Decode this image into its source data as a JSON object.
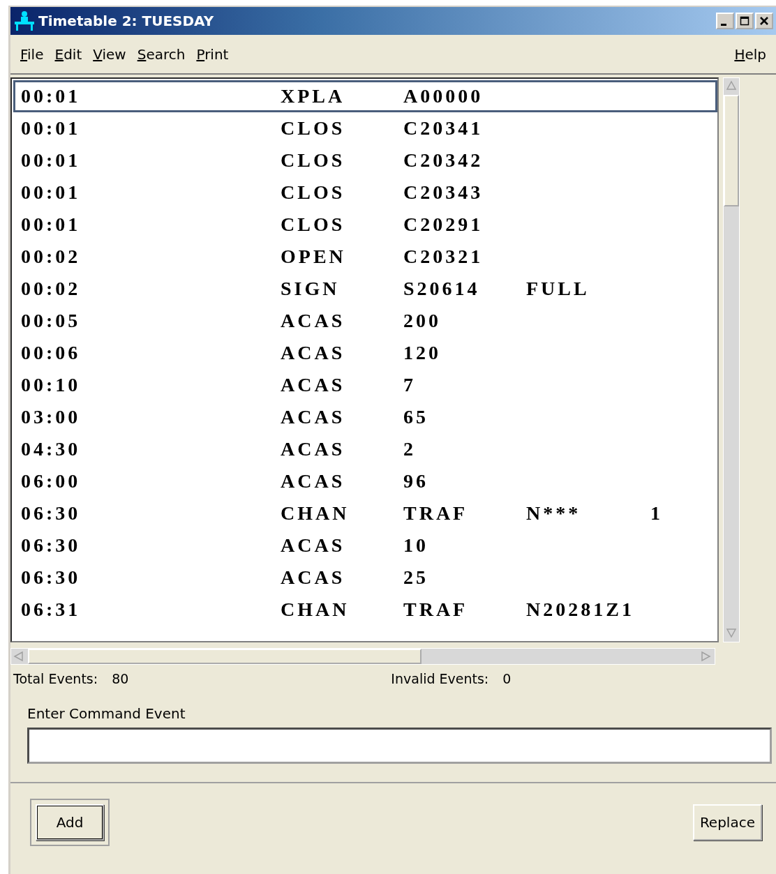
{
  "window": {
    "title": "Timetable 2: TUESDAY"
  },
  "menu": {
    "left": [
      {
        "label": "File"
      },
      {
        "label": "Edit"
      },
      {
        "label": "View"
      },
      {
        "label": "Search"
      },
      {
        "label": "Print"
      }
    ],
    "right": [
      {
        "label": "Help"
      }
    ]
  },
  "events": [
    {
      "cells": [
        "00:01",
        "XPLA",
        "A00000"
      ],
      "selected": true
    },
    {
      "cells": [
        "00:01",
        "CLOS",
        "C20341"
      ],
      "selected": false
    },
    {
      "cells": [
        "00:01",
        "CLOS",
        "C20342"
      ],
      "selected": false
    },
    {
      "cells": [
        "00:01",
        "CLOS",
        "C20343"
      ],
      "selected": false
    },
    {
      "cells": [
        "00:01",
        "CLOS",
        "C20291"
      ],
      "selected": false
    },
    {
      "cells": [
        "00:02",
        "OPEN",
        "C20321"
      ],
      "selected": false
    },
    {
      "cells": [
        "00:02",
        "SIGN",
        "S20614",
        "FULL"
      ],
      "selected": false
    },
    {
      "cells": [
        "00:05",
        "ACAS",
        "200"
      ],
      "selected": false
    },
    {
      "cells": [
        "00:06",
        "ACAS",
        "120"
      ],
      "selected": false
    },
    {
      "cells": [
        "00:10",
        "ACAS",
        "7"
      ],
      "selected": false
    },
    {
      "cells": [
        "03:00",
        "ACAS",
        "65"
      ],
      "selected": false
    },
    {
      "cells": [
        "04:30",
        "ACAS",
        "2"
      ],
      "selected": false
    },
    {
      "cells": [
        "06:00",
        "ACAS",
        "96"
      ],
      "selected": false
    },
    {
      "cells": [
        "06:30",
        "CHAN",
        "TRAF",
        "N***",
        "1"
      ],
      "selected": false
    },
    {
      "cells": [
        "06:30",
        "ACAS",
        "10"
      ],
      "selected": false
    },
    {
      "cells": [
        "06:30",
        "ACAS",
        "25"
      ],
      "selected": false
    },
    {
      "cells": [
        "06:31",
        "CHAN",
        "TRAF",
        "N20281Z1"
      ],
      "selected": false
    }
  ],
  "status": {
    "total_label": "Total Events:",
    "total_value": "80",
    "invalid_label": "Invalid Events:",
    "invalid_value": "0"
  },
  "command": {
    "label": "Enter Command Event"
  },
  "buttons": [
    {
      "label": "Add",
      "default": true
    },
    {
      "label": "Replace",
      "default": false
    }
  ]
}
